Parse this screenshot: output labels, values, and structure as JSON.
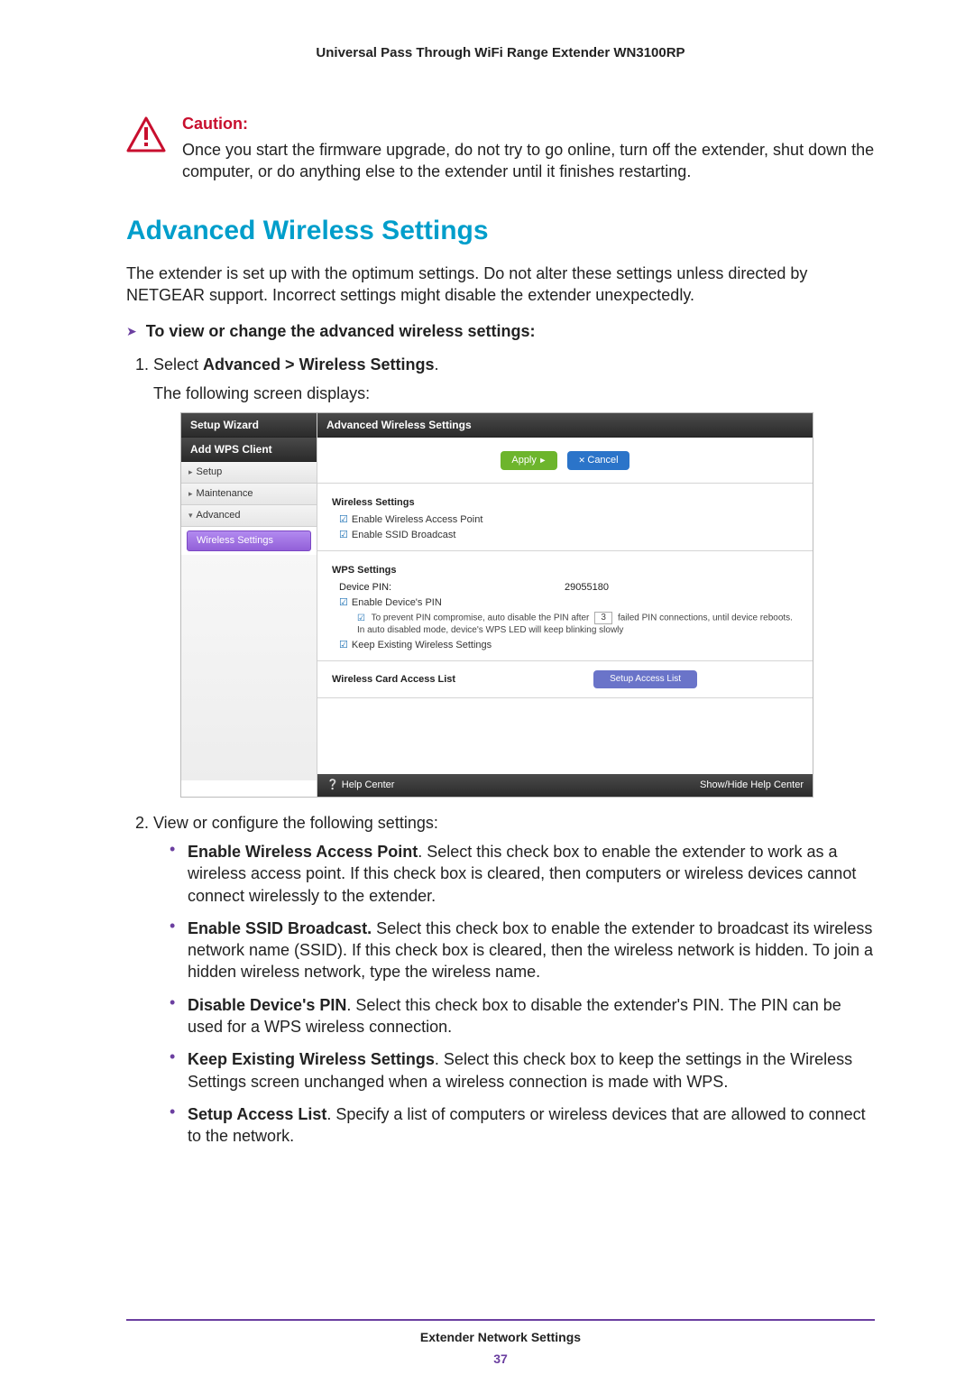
{
  "doc": {
    "header": "Universal Pass Through WiFi Range Extender WN3100RP",
    "footer_title": "Extender Network Settings",
    "page_number": "37"
  },
  "caution": {
    "label": "Caution:",
    "text": "Once you start the firmware upgrade, do not try to go online, turn off the extender, shut down the computer, or do anything else to the extender until it finishes restarting."
  },
  "section_title": "Advanced Wireless Settings",
  "intro": "The extender is set up with the optimum settings. Do not alter these settings unless directed by NETGEAR support. Incorrect settings might disable the extender unexpectedly.",
  "procedure_lead": "To view or change the advanced wireless settings:",
  "steps": {
    "one": {
      "prefix": "Select ",
      "bold": "Advanced > Wireless Settings",
      "suffix": "."
    },
    "one_follow": "The following screen displays:",
    "two": "View or configure the following settings:"
  },
  "bullets": [
    {
      "b": "Enable Wireless Access Point",
      "t": ". Select this check box to enable the extender to work as a wireless access point. If this check box is cleared, then computers or wireless devices cannot connect wirelessly to the extender."
    },
    {
      "b": "Enable SSID Broadcast.",
      "t": " Select this check box to enable the extender to broadcast its wireless network name (SSID). If this check box is cleared, then the wireless network is hidden. To join a hidden wireless network, type the wireless name."
    },
    {
      "b": "Disable Device's PIN",
      "t": ". Select this check box to disable the extender's PIN. The PIN can be used for a WPS wireless connection."
    },
    {
      "b": "Keep Existing Wireless Settings",
      "t": ". Select this check box to keep the settings in the Wireless Settings screen unchanged when a wireless connection is made with WPS."
    },
    {
      "b": "Setup Access List",
      "t": ". Specify a list of computers or wireless devices that are allowed to connect to the network."
    }
  ],
  "screenshot": {
    "sidebar": {
      "setup_wizard": "Setup Wizard",
      "add_wps": "Add WPS Client",
      "setup": "Setup",
      "maintenance": "Maintenance",
      "advanced": "Advanced",
      "wireless_settings": "Wireless Settings"
    },
    "main": {
      "title": "Advanced Wireless Settings",
      "apply": "Apply",
      "cancel": "Cancel",
      "ws_title": "Wireless Settings",
      "ws_chk1": "Enable Wireless Access Point",
      "ws_chk2": "Enable SSID Broadcast",
      "wps_title": "WPS Settings",
      "pin_label": "Device PIN:",
      "pin_value": "29055180",
      "wps_chk1": "Enable Device's PIN",
      "wps_note1_a": "To prevent PIN compromise, auto disable the PIN after",
      "wps_note1_n": "3",
      "wps_note1_b": "failed PIN connections, until device reboots.",
      "wps_note2": "In auto disabled mode, device's WPS LED will keep blinking slowly",
      "wps_chk2": "Keep Existing Wireless Settings",
      "access_label": "Wireless Card Access List",
      "access_btn": "Setup Access List",
      "help_left": "Help Center",
      "help_right": "Show/Hide Help Center"
    }
  }
}
